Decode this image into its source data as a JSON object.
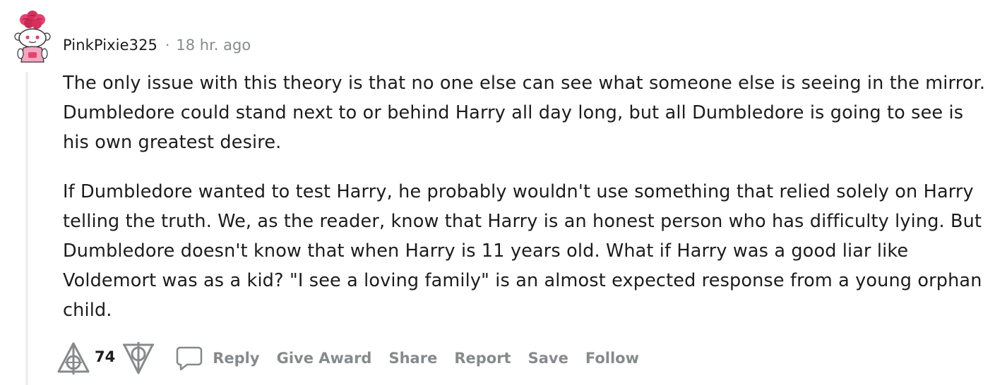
{
  "comment": {
    "author": "PinkPixie325",
    "separator": "·",
    "time": "18 hr. ago",
    "paragraphs": [
      "The only issue with this theory is that no one else can see what someone else is seeing in the mirror. Dumbledore could stand next to or behind Harry all day long, but all Dumbledore is going to see is his own greatest desire.",
      "If Dumbledore wanted to test Harry, he probably wouldn't use something that relied solely on Harry telling the truth. We, as the reader, know that Harry is an honest person who has difficulty lying. But Dumbledore doesn't know that when Harry is 11 years old. What if Harry was a good liar like Voldemort was as a kid? \"I see a loving family\" is an almost expected response from a young orphan child."
    ],
    "score": "74",
    "actions": {
      "reply": "Reply",
      "give_award": "Give Award",
      "share": "Share",
      "report": "Report",
      "save": "Save",
      "follow": "Follow"
    }
  },
  "icons": {
    "avatar": "snoo-avatar-pink-rose-hair",
    "upvote": "deathly-hallows-upvote-icon",
    "downvote": "deathly-hallows-downvote-icon",
    "reply": "speech-bubble-icon"
  },
  "colors": {
    "text": "#1c1c1c",
    "muted": "#878a8c",
    "thread_line": "#edeff1",
    "avatar_pink": "#e8416f"
  }
}
